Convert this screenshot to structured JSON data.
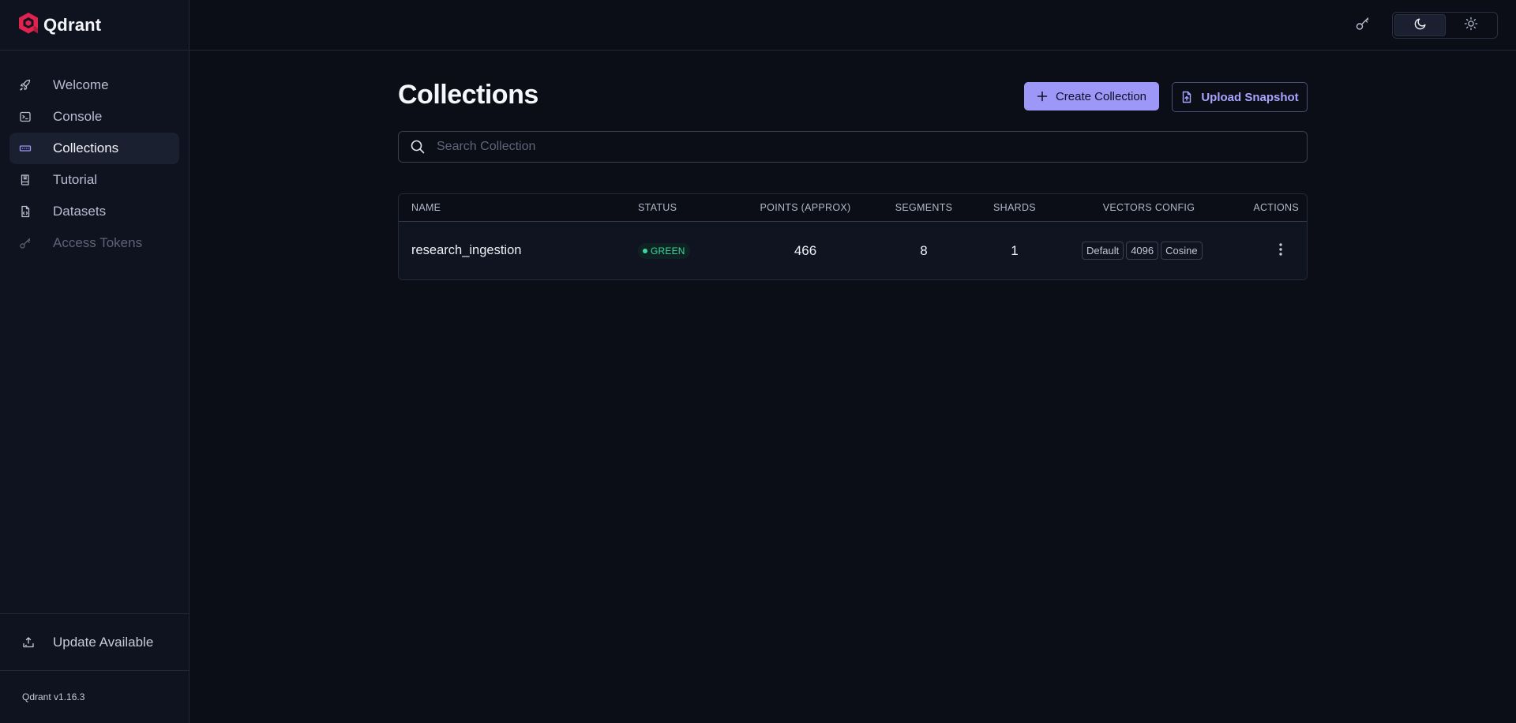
{
  "brand": {
    "name": "Qdrant",
    "logo_icon": "qdrant-logo-icon"
  },
  "sidebar": {
    "items": [
      {
        "label": "Welcome",
        "icon": "rocket-icon"
      },
      {
        "label": "Console",
        "icon": "terminal-icon"
      },
      {
        "label": "Collections",
        "icon": "collections-icon",
        "active": true
      },
      {
        "label": "Tutorial",
        "icon": "book-icon"
      },
      {
        "label": "Datasets",
        "icon": "file-icon"
      },
      {
        "label": "Access Tokens",
        "icon": "key-icon",
        "disabled": true
      }
    ],
    "update_label": "Update Available",
    "version": "Qdrant v1.16.3"
  },
  "topbar": {
    "theme_selected": "dark"
  },
  "main": {
    "title": "Collections",
    "create_label": "Create Collection",
    "upload_label": "Upload Snapshot",
    "search_placeholder": "Search Collection",
    "search_value": ""
  },
  "table": {
    "headers": [
      "NAME",
      "STATUS",
      "POINTS (APPROX)",
      "SEGMENTS",
      "SHARDS",
      "VECTORS CONFIG",
      "ACTIONS"
    ],
    "rows": [
      {
        "name": "research_ingestion",
        "status": "GREEN",
        "points": "466",
        "segments": "8",
        "shards": "1",
        "vectors": [
          "Default",
          "4096",
          "Cosine"
        ]
      }
    ]
  },
  "colors": {
    "accent": "#9d97f7",
    "status_green": "#3bd7a2",
    "background": "#0b0e17",
    "brand": "#e0224f"
  }
}
